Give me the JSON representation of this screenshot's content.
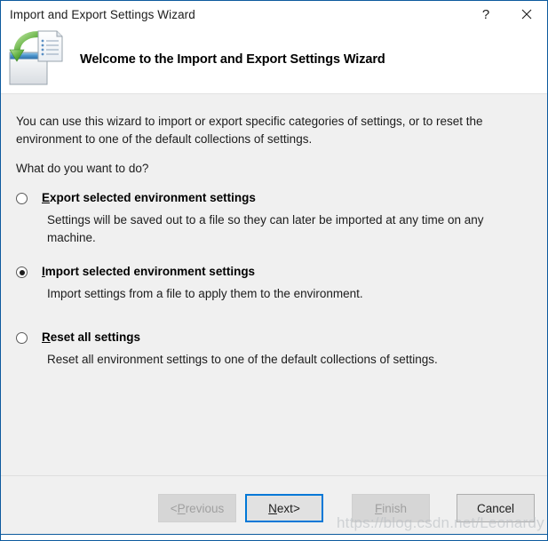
{
  "window": {
    "title": "Import and Export Settings Wizard",
    "frame_color": "#0d5a9e",
    "body_bg": "#f0f0f0",
    "header_bg": "#ffffff"
  },
  "titlebar": {
    "help_glyph": "?",
    "help_name": "help-icon",
    "close_name": "close-icon"
  },
  "header": {
    "icon_name": "import-export-settings-icon",
    "title": "Welcome to the Import and Export Settings Wizard"
  },
  "main": {
    "intro": "You can use this wizard to import or export specific categories of settings, or to reset the environment to one of the default collections of settings.",
    "question": "What do you want to do?",
    "options": [
      {
        "id": "export",
        "accel": "E",
        "label_rest": "xport selected environment settings",
        "label_full": "Export selected environment settings",
        "description": "Settings will be saved out to a file so they can later be imported at any time on any machine.",
        "selected": false
      },
      {
        "id": "import",
        "accel": "I",
        "label_rest": "mport selected environment settings",
        "label_full": "Import selected environment settings",
        "description": "Import settings from a file to apply them to the environment.",
        "selected": true
      },
      {
        "id": "reset",
        "accel": "R",
        "label_rest": "eset all settings",
        "label_full": "Reset all settings",
        "description": "Reset all environment settings to one of the default collections of settings.",
        "selected": false
      }
    ]
  },
  "footer": {
    "buttons": [
      {
        "id": "previous",
        "prefix": "< ",
        "accel": "P",
        "rest": "revious",
        "suffix": "",
        "full": "< Previous",
        "state": "disabled"
      },
      {
        "id": "next",
        "prefix": "",
        "accel": "N",
        "rest": "ext",
        "suffix": " >",
        "full": "Next >",
        "state": "focused"
      },
      {
        "id": "finish",
        "prefix": "",
        "accel": "F",
        "rest": "inish",
        "suffix": "",
        "full": "Finish",
        "state": "disabled"
      },
      {
        "id": "cancel",
        "prefix": "",
        "accel": "",
        "rest": "Cancel",
        "suffix": "",
        "full": "Cancel",
        "state": "normal"
      }
    ]
  },
  "watermark": {
    "text": "https://blog.csdn.net/Leonardy"
  }
}
